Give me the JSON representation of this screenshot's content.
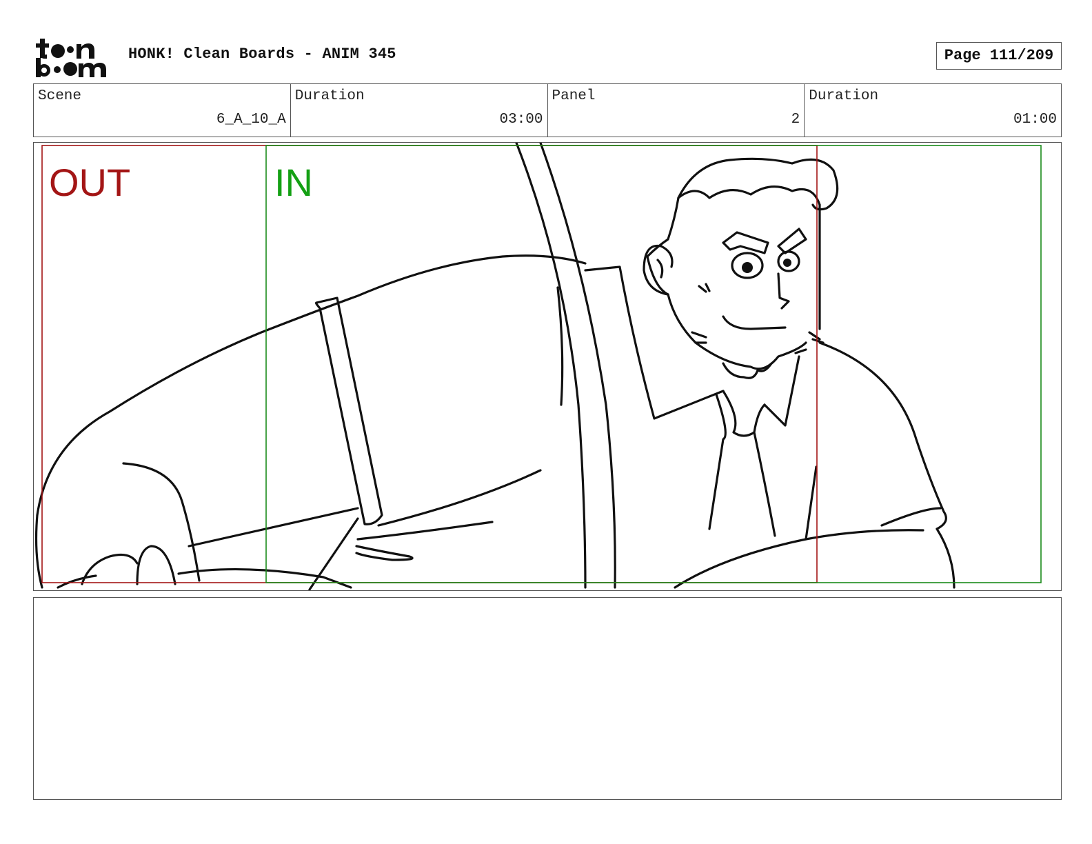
{
  "header": {
    "logo_text": "toonboom",
    "title": "HONK! Clean Boards - ANIM 345",
    "page_label": "Page 111/209"
  },
  "info_bar": {
    "scene_label": "Scene",
    "scene_value": "6_A_10_A",
    "scene_duration_label": "Duration",
    "scene_duration_value": "03:00",
    "panel_label": "Panel",
    "panel_value": "2",
    "panel_duration_label": "Duration",
    "panel_duration_value": "01:00"
  },
  "panel": {
    "camera_out_label": "OUT",
    "camera_in_label": "IN",
    "colors": {
      "out_frame": "#a31515",
      "in_frame": "#1a8a1a",
      "in_text": "#14a014",
      "ink": "#111111"
    }
  },
  "notes": {
    "text": ""
  }
}
